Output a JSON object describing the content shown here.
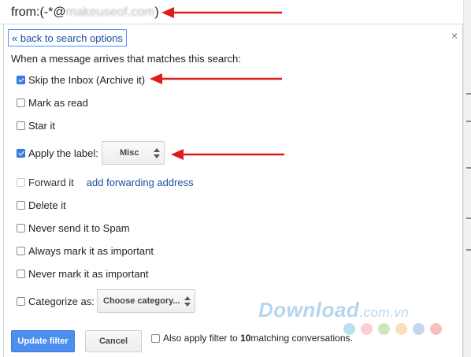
{
  "search": {
    "query_prefix": "from:(-*@",
    "query_blurred": "makeuseof.com",
    "query_suffix": ")"
  },
  "panel": {
    "back_link": "« back to search options",
    "close_label": "×",
    "intro": "When a message arrives that matches this search:"
  },
  "actions": [
    {
      "label": "Skip the Inbox (Archive it)",
      "checked": true
    },
    {
      "label": "Mark as read",
      "checked": false
    },
    {
      "label": "Star it",
      "checked": false
    },
    {
      "label": "Apply the label:",
      "checked": true
    },
    {
      "label": "Forward it",
      "checked": false,
      "disabled": true
    },
    {
      "label": "Delete it",
      "checked": false
    },
    {
      "label": "Never send it to Spam",
      "checked": false
    },
    {
      "label": "Always mark it as important",
      "checked": false
    },
    {
      "label": "Never mark it as important",
      "checked": false
    },
    {
      "label": "Categorize as:",
      "checked": false
    }
  ],
  "forward_link": "add forwarding address",
  "label_select": {
    "value": "Misc"
  },
  "category_select": {
    "value": "Choose category..."
  },
  "footer": {
    "update_button": "Update filter",
    "cancel_button": "Cancel",
    "also_apply_prefix": "Also apply filter to ",
    "also_apply_count": "10",
    "also_apply_suffix": " matching conversations."
  },
  "watermark": {
    "text": "Download",
    "domain": ".com.vn"
  },
  "colors": {
    "accent": "#4d8ff0",
    "link": "#1a4ea0",
    "annotation_arrow": "#e01b1b"
  },
  "icons": [
    "checkbox-icon",
    "up-down-icon",
    "close-icon",
    "red-arrow-annotation"
  ]
}
